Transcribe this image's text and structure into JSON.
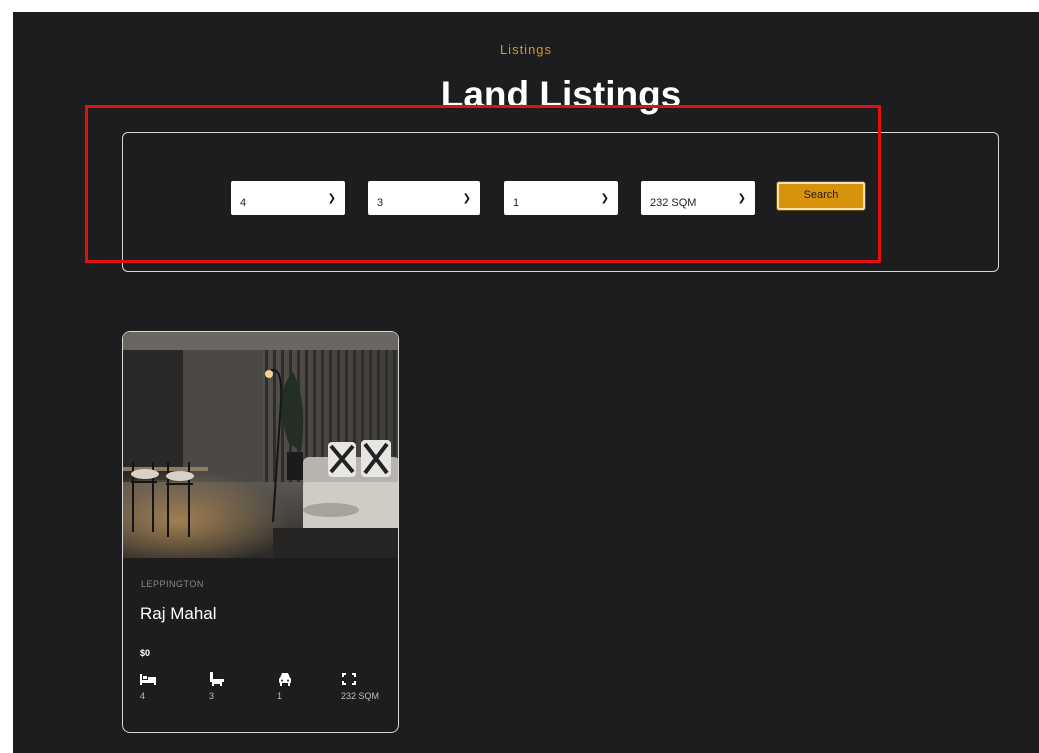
{
  "header": {
    "eyebrow": "Listings",
    "title": "Land Listings"
  },
  "search": {
    "filters": [
      {
        "name": "bedrooms",
        "selected": "4"
      },
      {
        "name": "bathrooms",
        "selected": "3"
      },
      {
        "name": "parking",
        "selected": "1"
      },
      {
        "name": "land-size",
        "selected": "232 SQM"
      }
    ],
    "button_label": "Search"
  },
  "listings": [
    {
      "suburb": "LEPPINGTON",
      "title": "Raj Mahal",
      "price": "$0",
      "bedrooms": "4",
      "bathrooms": "3",
      "parking": "1",
      "land_size": "232 SQM",
      "icons": [
        "bed-icon",
        "bath-icon",
        "car-icon",
        "area-icon"
      ]
    }
  ],
  "colors": {
    "background": "#1d1d1f",
    "accent": "#d19a26",
    "button": "#d8930e",
    "highlight": "#e01010"
  }
}
